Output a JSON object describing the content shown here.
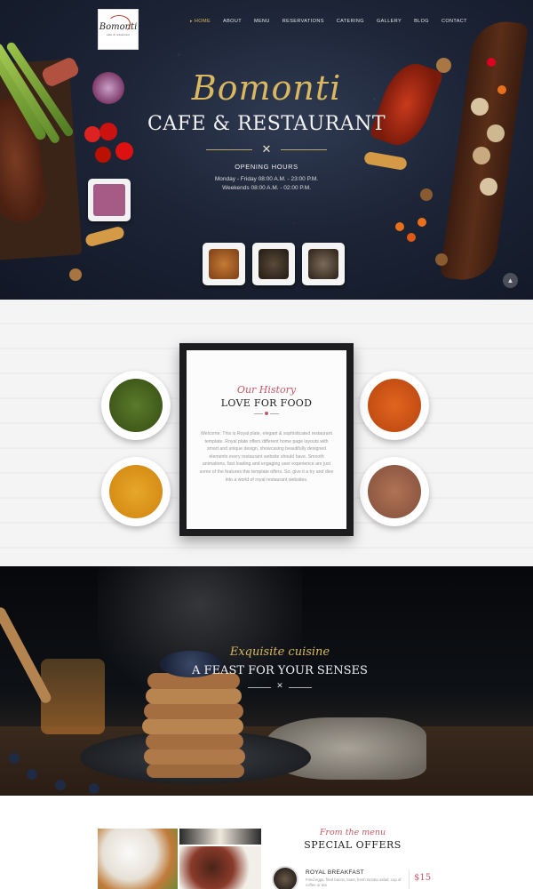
{
  "brand": {
    "logo_text": "Bomonti",
    "logo_subtext": "cafe & restaurant"
  },
  "nav": {
    "items": [
      {
        "label": "HOME",
        "active": true
      },
      {
        "label": "ABOUT"
      },
      {
        "label": "MENU"
      },
      {
        "label": "RESERVATIONS"
      },
      {
        "label": "CATERING"
      },
      {
        "label": "GALLERY"
      },
      {
        "label": "BLOG"
      },
      {
        "label": "CONTACT"
      }
    ]
  },
  "hero": {
    "script_title": "Bomonti",
    "title": "CAFE & RESTAURANT",
    "hours_title": "OPENING HOURS",
    "hours_weekday": "Monday - Friday 08:00 A.M. - 23:00 P.M.",
    "hours_weekend": "Weekends 08:00 A.M. - 02:00 P.M.",
    "divider_icon": "cutlery-icon",
    "scroll_icon": "scroll-up-icon"
  },
  "about": {
    "script": "Our History",
    "title": "LOVE FOR FOOD",
    "text": "Welcome. This is Royal plate, elegant & sophisticated restaurant template. Royal plate offers different home page layouts with smart and unique design, showcasing beautifully designed elements every restaurant website should have. Smooth animations, fast loading and engaging user experience are just some of the features this template offers. So, give it a try and dive into a world of royal restaurant websites."
  },
  "feast": {
    "script": "Exquisite cuisine",
    "title": "A FEAST FOR YOUR SENSES"
  },
  "offers": {
    "script": "From the menu",
    "title": "SPECIAL OFFERS",
    "items": [
      {
        "name": "ROYAL BREAKFAST",
        "description": "Fried eggs, fried bacon, toast, fresh tomato salad, cup of coffee or tea",
        "price": "$15"
      }
    ]
  },
  "colors": {
    "accent_gold": "#d9b860",
    "accent_rose": "#c45a66",
    "hero_bg": "#1c2436"
  }
}
